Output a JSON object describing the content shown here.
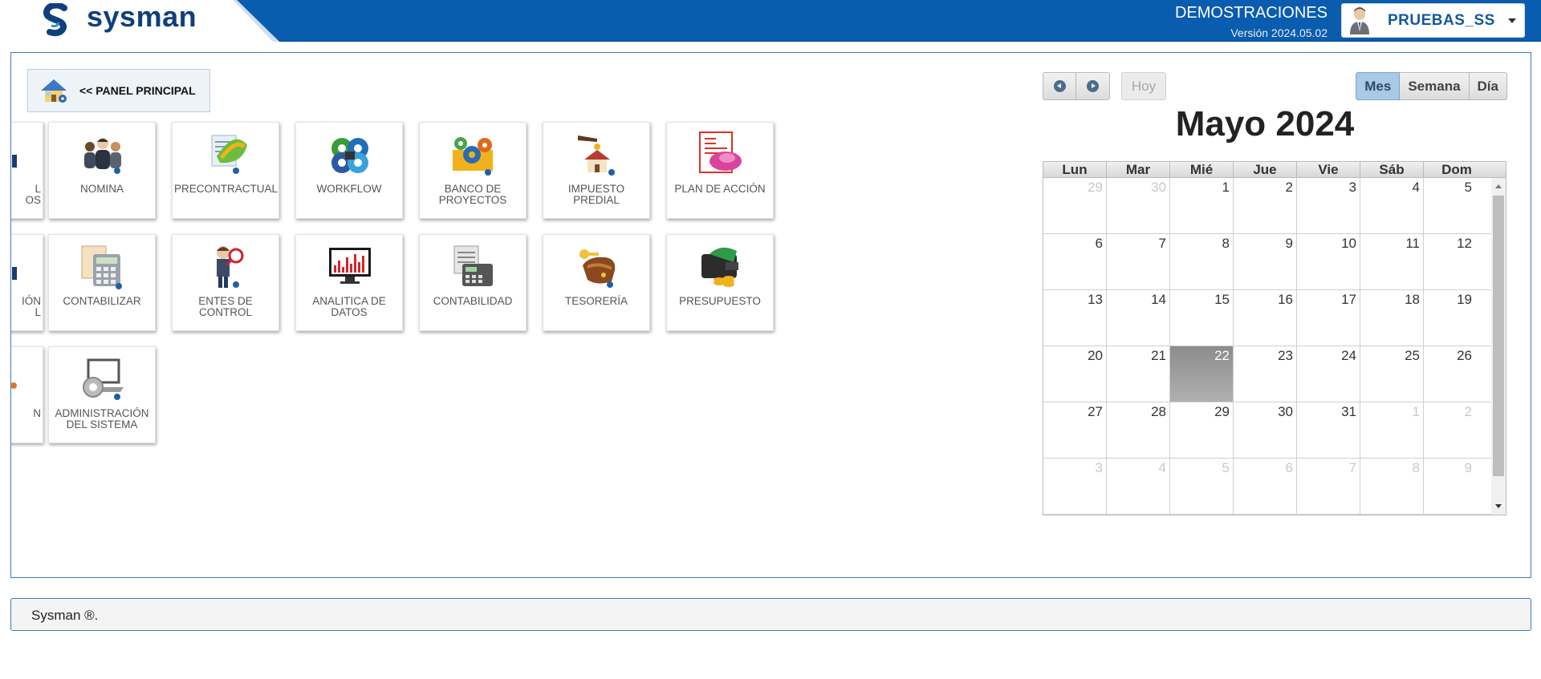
{
  "header": {
    "brand": "sysman",
    "company": "DEMOSTRACIONES",
    "version": "Versión 2024.05.02",
    "user": "PRUEBAS_SS",
    "colors": {
      "bar": "#0a5cae",
      "brand": "#0f3f7c"
    }
  },
  "panel_button": {
    "label": "<< PANEL PRINCIPAL",
    "icon": "house-icon"
  },
  "modules_row1": [
    {
      "label": "L\nOS",
      "icon": "partial-icon"
    },
    {
      "label": "NOMINA",
      "icon": "people-icon"
    },
    {
      "label": "PRECONTRACTUAL",
      "icon": "document-icon"
    },
    {
      "label": "WORKFLOW",
      "icon": "gears-icon"
    },
    {
      "label": "BANCO DE PROYECTOS",
      "icon": "gear-project-icon"
    },
    {
      "label": "IMPUESTO PREDIAL",
      "icon": "house-tax-icon"
    },
    {
      "label": "PLAN DE ACCIÓN",
      "icon": "plan-icon"
    }
  ],
  "modules_row2": [
    {
      "label": "IÓN\nL",
      "icon": "partial-icon"
    },
    {
      "label": "CONTABILIZAR",
      "icon": "calculator-icon"
    },
    {
      "label": "ENTES DE CONTROL",
      "icon": "inspector-icon"
    },
    {
      "label": "ANALITICA DE DATOS",
      "icon": "monitor-chart-icon"
    },
    {
      "label": "CONTABILIDAD",
      "icon": "cash-register-icon"
    },
    {
      "label": "TESORERÍA",
      "icon": "treasure-icon"
    },
    {
      "label": "PRESUPUESTO",
      "icon": "wallet-icon"
    }
  ],
  "modules_row3": [
    {
      "label": "N",
      "icon": "partial-icon"
    },
    {
      "label": "ADMINISTRACIÓN DEL SISTEMA",
      "icon": "laptop-gear-icon"
    }
  ],
  "calendar": {
    "today_label": "Hoy",
    "views": [
      "Mes",
      "Semana",
      "Día"
    ],
    "active_view": "Mes",
    "title": "Mayo 2024",
    "dow": [
      "Lun",
      "Mar",
      "Mié",
      "Jue",
      "Vie",
      "Sáb",
      "Dom"
    ],
    "weeks": [
      [
        "29",
        "30",
        "1",
        "2",
        "3",
        "4",
        "5"
      ],
      [
        "6",
        "7",
        "8",
        "9",
        "10",
        "11",
        "12"
      ],
      [
        "13",
        "14",
        "15",
        "16",
        "17",
        "18",
        "19"
      ],
      [
        "20",
        "21",
        "22",
        "23",
        "24",
        "25",
        "26"
      ],
      [
        "27",
        "28",
        "29",
        "30",
        "31",
        "1",
        "2"
      ],
      [
        "3",
        "4",
        "5",
        "6",
        "7",
        "8",
        "9"
      ]
    ],
    "today": "22"
  },
  "footer": {
    "text": "Sysman ®."
  }
}
